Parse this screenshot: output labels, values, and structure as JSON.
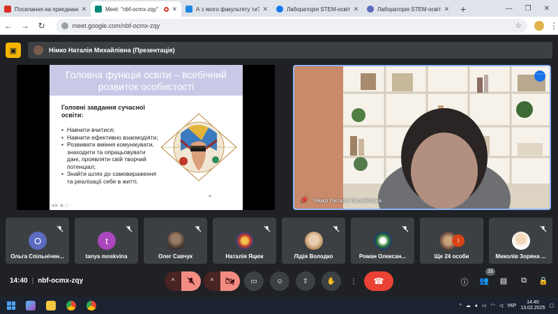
{
  "browser": {
    "tabs": [
      {
        "title": "Посилання на приєднанн",
        "color": "#d93025",
        "active": false
      },
      {
        "title": "Meet: \"nbf-ocmx-zqy\"",
        "color": "#00897b",
        "active": true
      },
      {
        "title": "А з якого факультету ти? Я",
        "color": "#1e88e5",
        "active": false
      },
      {
        "title": "Лабораторія STEM-освіти",
        "color": "#1877f2",
        "active": false
      },
      {
        "title": "Лабораторія STEM-освіти",
        "color": "#5c6bc0",
        "active": false
      }
    ],
    "address": "meet.google.com/nbf-ocmx-zqy"
  },
  "presentation": {
    "presenter_label": "Німко Наталія Михайлівна (Презентація)"
  },
  "slide": {
    "title": "Головна функція освіти – всебічний розвиток особистості",
    "heading": "Головні завдання сучасної освіти:",
    "bullets": [
      "Навчити вчитися;",
      "Навчити ефективно взаємодіяти;",
      "Розвивати вміння комунікувати, знаходити та опрацьовувати дані, проявляти свій творчий потенціал;",
      "Знайти шлях до самовираження та реалізації себе в житті."
    ]
  },
  "speaker": {
    "name": "Німко Наталія Михайлівна"
  },
  "participants": [
    {
      "name": "Ольга Спільнічен...",
      "initial": "О",
      "color": "#5c6bc0"
    },
    {
      "name": "tanya moskvina",
      "initial": "t",
      "color": "#ab47bc"
    },
    {
      "name": "Олег Савчук",
      "initial": "",
      "color": "#5d4037"
    },
    {
      "name": "Наталія Яцюк",
      "initial": "",
      "color": "#6d4c8f"
    },
    {
      "name": "Лідія Володко",
      "initial": "",
      "color": "#c9a27a"
    },
    {
      "name": "Роман Олексан...",
      "initial": "",
      "color": "#2e7d32"
    },
    {
      "name": "Ще 24 особи",
      "initial": "",
      "color": "#8d6e63"
    },
    {
      "name": "Миколів Зоряна ...",
      "initial": "",
      "color": "#e0b080"
    }
  ],
  "controls": {
    "time": "14:40",
    "code": "nbf-ocmx-zqy",
    "people_count": "33"
  },
  "taskbar": {
    "lang": "УКР",
    "time": "14:40",
    "date": "13.02.2025"
  }
}
